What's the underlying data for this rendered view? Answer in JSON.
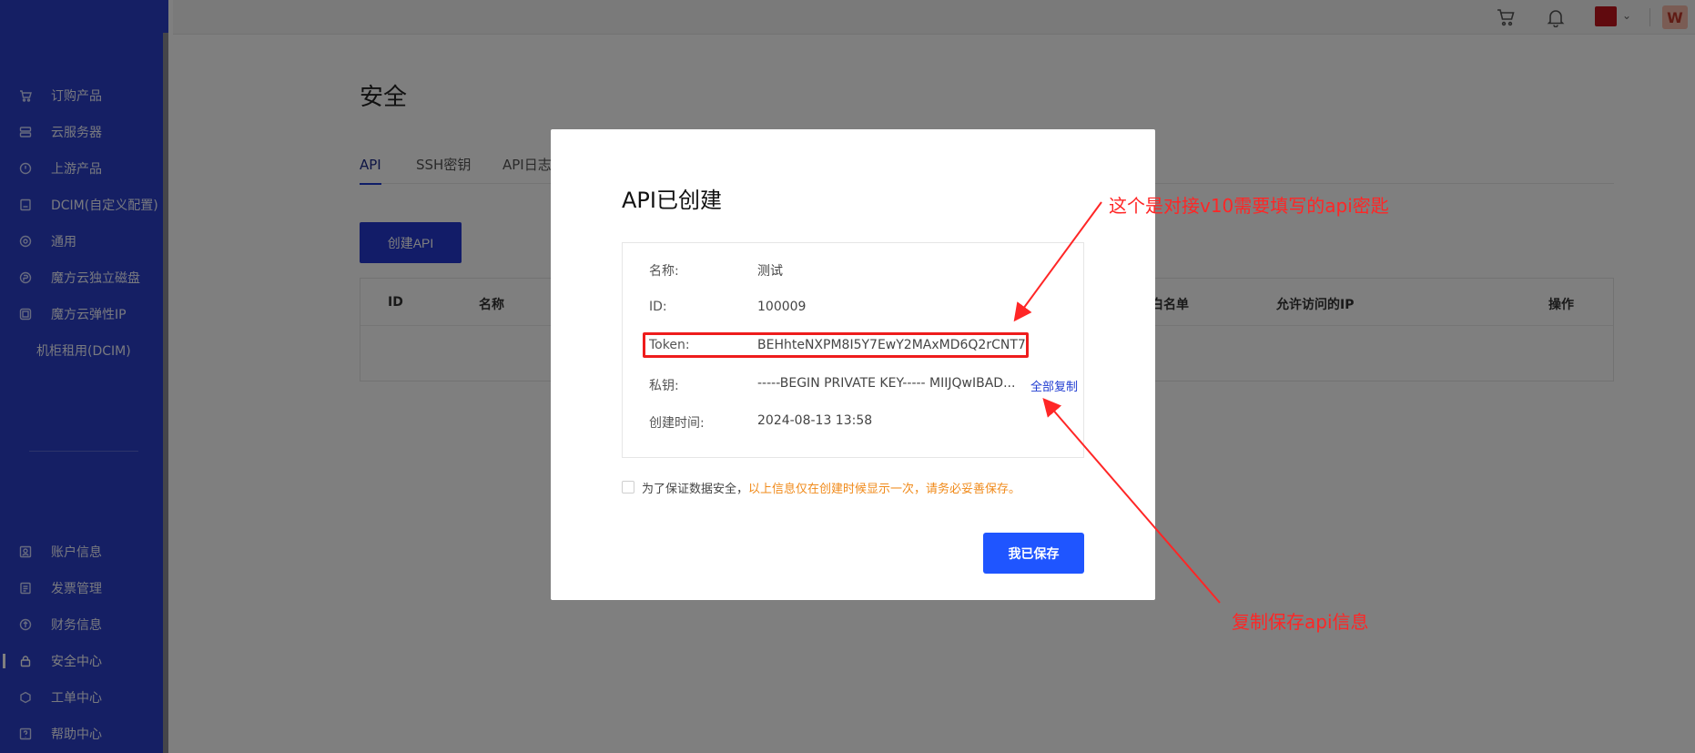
{
  "sidebar": {
    "items": [
      {
        "label": "订购产品",
        "icon": "cart-icon"
      },
      {
        "label": "云服务器",
        "icon": "server-icon"
      },
      {
        "label": "上游产品",
        "icon": "upstream-icon"
      },
      {
        "label": "DCIM(自定义配置)",
        "icon": "dcim-icon"
      },
      {
        "label": "通用",
        "icon": "general-icon"
      },
      {
        "label": "魔方云独立磁盘",
        "icon": "disk-icon"
      },
      {
        "label": "魔方云弹性IP",
        "icon": "elastic-ip-icon"
      },
      {
        "label": "机柜租用(DCIM)",
        "icon": ""
      },
      {
        "label": "账户信息",
        "icon": "account-icon"
      },
      {
        "label": "发票管理",
        "icon": "invoice-icon"
      },
      {
        "label": "财务信息",
        "icon": "finance-icon"
      },
      {
        "label": "安全中心",
        "icon": "lock-icon"
      },
      {
        "label": "工单中心",
        "icon": "ticket-icon"
      },
      {
        "label": "帮助中心",
        "icon": "help-icon"
      }
    ]
  },
  "header": {
    "avatar_initial": "W"
  },
  "main": {
    "title": "安全",
    "tabs": [
      "API",
      "SSH密钥",
      "API日志"
    ],
    "create_button": "创建API",
    "table_headers": [
      "ID",
      "名称",
      "白名单",
      "允许访问的IP",
      "操作"
    ]
  },
  "modal": {
    "title": "API已创建",
    "rows": [
      {
        "label": "名称:",
        "value": "测试"
      },
      {
        "label": "ID:",
        "value": "100009"
      },
      {
        "label": "Token:",
        "value": "BEHhteNXPM8I5Y7EwY2MAxMD6Q2rCNT7"
      },
      {
        "label": "私钥:",
        "value": "-----BEGIN PRIVATE KEY----- MIIJQwIBAD..."
      },
      {
        "label": "创建时间:",
        "value": "2024-08-13 13:58"
      }
    ],
    "copy_all": "全部复制",
    "notice_prefix": "为了保证数据安全，",
    "notice_warning": "以上信息仅在创建时候显示一次，请务必妥善保存。",
    "save_button": "我已保存"
  },
  "annotations": {
    "token_note": "这个是对接v10需要填写的api密匙",
    "copy_note": "复制保存api信息",
    "color": "#ff2626"
  },
  "colors": {
    "sidebar": "#2b3ec8",
    "primary": "#1f55ff",
    "warning": "#f08a1a"
  }
}
